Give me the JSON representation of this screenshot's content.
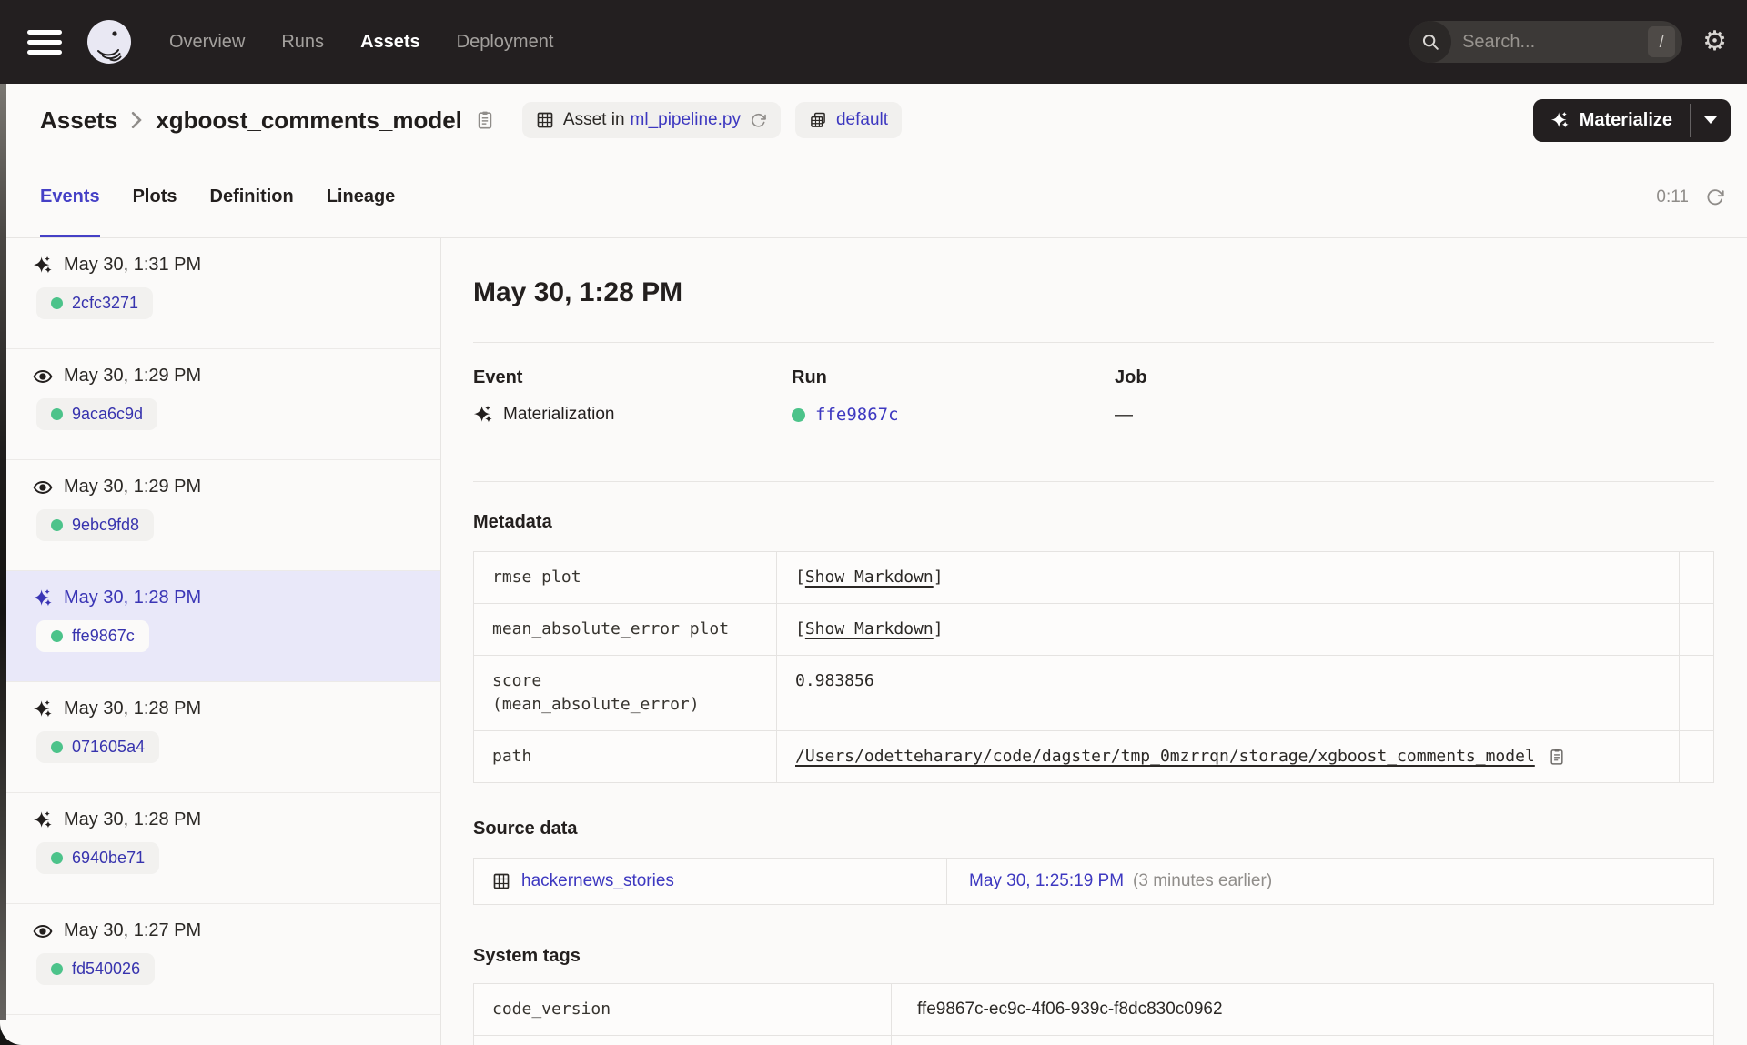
{
  "nav": {
    "items": [
      {
        "label": "Overview",
        "active": false
      },
      {
        "label": "Runs",
        "active": false
      },
      {
        "label": "Assets",
        "active": true
      },
      {
        "label": "Deployment",
        "active": false
      }
    ],
    "search": {
      "placeholder": "Search...",
      "shortcut": "/"
    }
  },
  "header": {
    "breadcrumb": {
      "root": "Assets",
      "current": "xgboost_comments_model"
    },
    "badges": {
      "asset_in": {
        "prefix": "Asset in",
        "link": "ml_pipeline.py"
      },
      "group": {
        "label": "default"
      }
    },
    "materialize_label": "Materialize"
  },
  "tabs": {
    "items": [
      {
        "label": "Events",
        "active": true
      },
      {
        "label": "Plots",
        "active": false
      },
      {
        "label": "Definition",
        "active": false
      },
      {
        "label": "Lineage",
        "active": false
      }
    ],
    "timer": "0:11"
  },
  "sidebar": {
    "events": [
      {
        "type": "materialization",
        "time": "May 30, 1:31 PM",
        "run_id": "2cfc3271",
        "selected": false
      },
      {
        "type": "observation",
        "time": "May 30, 1:29 PM",
        "run_id": "9aca6c9d",
        "selected": false
      },
      {
        "type": "observation",
        "time": "May 30, 1:29 PM",
        "run_id": "9ebc9fd8",
        "selected": false
      },
      {
        "type": "materialization",
        "time": "May 30, 1:28 PM",
        "run_id": "ffe9867c",
        "selected": true
      },
      {
        "type": "materialization",
        "time": "May 30, 1:28 PM",
        "run_id": "071605a4",
        "selected": false
      },
      {
        "type": "materialization",
        "time": "May 30, 1:28 PM",
        "run_id": "6940be71",
        "selected": false
      },
      {
        "type": "observation",
        "time": "May 30, 1:27 PM",
        "run_id": "fd540026",
        "selected": false
      }
    ]
  },
  "detail": {
    "title": "May 30, 1:28 PM",
    "event": {
      "label": "Event",
      "value": "Materialization"
    },
    "run": {
      "label": "Run",
      "value": "ffe9867c"
    },
    "job": {
      "label": "Job",
      "value": "—"
    },
    "metadata": {
      "heading": "Metadata",
      "rows": [
        {
          "key": "rmse plot",
          "type": "markdown",
          "value": "[Show Markdown]"
        },
        {
          "key": "mean_absolute_error plot",
          "type": "markdown",
          "value": "[Show Markdown]"
        },
        {
          "key": "score (mean_absolute_error)",
          "type": "text",
          "value": "0.983856"
        },
        {
          "key": "path",
          "type": "path",
          "value": "/Users/odetteharary/code/dagster/tmp_0mzrrqn/storage/xgboost_comments_model"
        }
      ]
    },
    "source_data": {
      "heading": "Source data",
      "asset": "hackernews_stories",
      "time": "May 30, 1:25:19 PM",
      "time_note": "(3 minutes earlier)"
    },
    "system_tags": {
      "heading": "System tags",
      "rows": [
        {
          "key": "code_version",
          "value": "ffe9867c-ec9c-4f06-939c-f8dc830c0962"
        }
      ]
    }
  },
  "colors": {
    "nav_bg": "#231F20",
    "accent_link": "#3D38C0",
    "active_tab": "#4540C6",
    "selected_event_bg": "#E9E8F9",
    "run_status_green": "#4CC38A"
  }
}
